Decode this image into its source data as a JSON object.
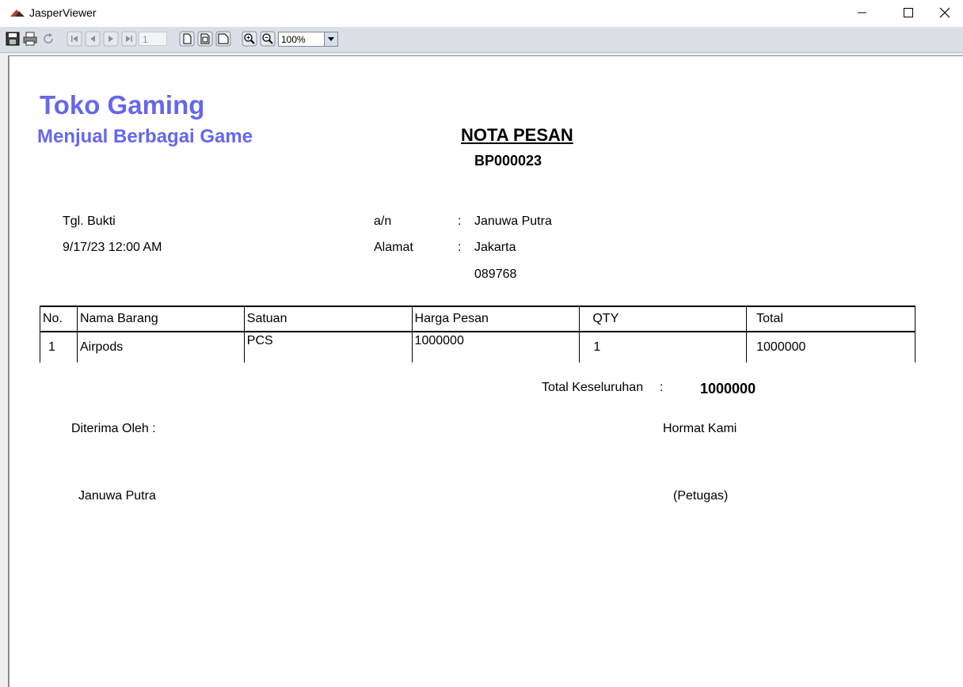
{
  "window": {
    "title": "JasperViewer"
  },
  "toolbar": {
    "page_number": "1",
    "zoom": "100%",
    "buttons": [
      "save-icon",
      "print-icon",
      "reload-icon",
      "first-page-icon",
      "previous-page-icon",
      "next-page-icon",
      "last-page-icon",
      "actual-size-icon",
      "fit-page-icon",
      "fit-width-icon",
      "zoom-in-icon",
      "zoom-out-icon"
    ]
  },
  "report": {
    "company": "Toko Gaming",
    "tagline": "Menjual Berbagai Game",
    "title": "NOTA PESAN",
    "number": "BP000023",
    "date_label": "Tgl. Bukti",
    "date_value": "9/17/23 12:00 AM",
    "an_label": "a/n",
    "an_value": "Januwa Putra",
    "address_label": "Alamat",
    "address_value": "Jakarta",
    "phone_value": "089768",
    "colon": ":",
    "table": {
      "headers": [
        "No.",
        "Nama Barang",
        "Satuan",
        "Harga Pesan",
        "QTY",
        "Total"
      ],
      "rows": [
        [
          "1",
          "Airpods",
          "PCS",
          "1000000",
          "1",
          "1000000"
        ]
      ]
    },
    "total_label": "Total Keseluruhan",
    "total_value": "1000000",
    "received_by_label": "Diterima Oleh :",
    "regards_label": "Hormat Kami",
    "received_by_name": "Januwa Putra",
    "officer_label": "(Petugas)"
  },
  "colors": {
    "brand": "#6666ee",
    "toolbar": "#dcdfe6"
  }
}
